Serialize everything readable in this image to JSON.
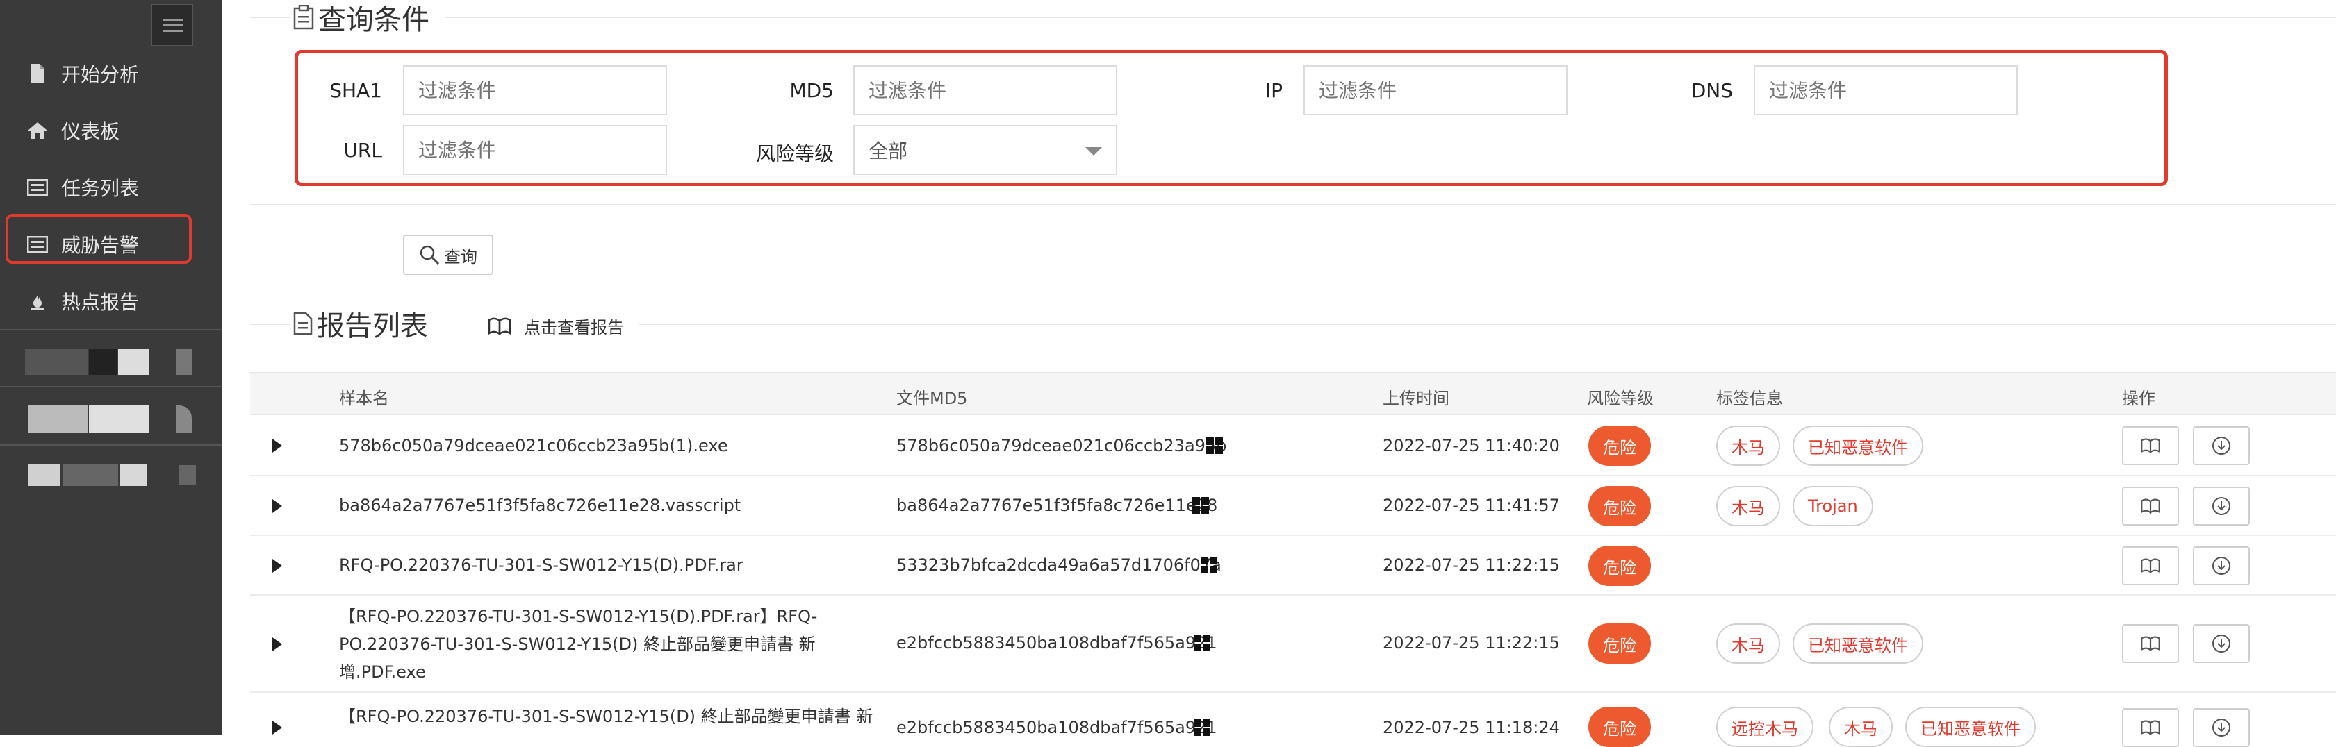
{
  "sidebar": {
    "items": [
      {
        "label": "开始分析",
        "icon": "file-icon"
      },
      {
        "label": "仪表板",
        "icon": "home-icon"
      },
      {
        "label": "任务列表",
        "icon": "list-icon"
      },
      {
        "label": "威胁告警",
        "icon": "list-icon",
        "active": true
      },
      {
        "label": "热点报告",
        "icon": "flame-icon"
      }
    ]
  },
  "query": {
    "title": "查询条件",
    "fields": {
      "sha1_label": "SHA1",
      "md5_label": "MD5",
      "ip_label": "IP",
      "dns_label": "DNS",
      "url_label": "URL",
      "risk_label": "风险等级",
      "placeholder": "过滤条件",
      "risk_value": "全部"
    },
    "button": "查询"
  },
  "report": {
    "title": "报告列表",
    "view_link": "点击查看报告",
    "columns": {
      "name": "样本名",
      "md5": "文件MD5",
      "time": "上传时间",
      "risk": "风险等级",
      "tags": "标签信息",
      "ops": "操作"
    },
    "rows": [
      {
        "name": "578b6c050a79dceae021c06ccb23a95b(1).exe",
        "md5": "578b6c050a79dceae021c06ccb23a95b",
        "time": "2022-07-25 11:40:20",
        "risk": "危险",
        "tags": [
          "木马",
          "已知恶意软件"
        ]
      },
      {
        "name": "ba864a2a7767e51f3f5fa8c726e11e28.vasscript",
        "md5": "ba864a2a7767e51f3f5fa8c726e11e28",
        "time": "2022-07-25 11:41:57",
        "risk": "危险",
        "tags": [
          "木马",
          "Trojan"
        ]
      },
      {
        "name": "RFQ-PO.220376-TU-301-S-SW012-Y15(D).PDF.rar",
        "md5": "53323b7bfca2dcda49a6a57d1706f07a",
        "time": "2022-07-25 11:22:15",
        "risk": "危险",
        "tags": []
      },
      {
        "name_lines": [
          "【RFQ-PO.220376-TU-301-S-SW012-Y15(D).PDF.rar】RFQ-",
          "PO.220376-TU-301-S-SW012-Y15(D) 終止部品變更申請書 新",
          "增.PDF.exe"
        ],
        "md5": "e2bfccb5883450ba108dbaf7f565a921",
        "time": "2022-07-25 11:22:15",
        "risk": "危险",
        "tags": [
          "木马",
          "已知恶意软件"
        ]
      },
      {
        "name_lines": [
          "【RFQ-PO.220376-TU-301-S-SW012-Y15(D) 終止部品變更申請書 新"
        ],
        "md5": "e2bfccb5883450ba108dbaf7f565a921",
        "time": "2022-07-25 11:18:24",
        "risk": "危险",
        "tags": [
          "远控木马",
          "木马",
          "已知恶意软件"
        ]
      }
    ]
  }
}
